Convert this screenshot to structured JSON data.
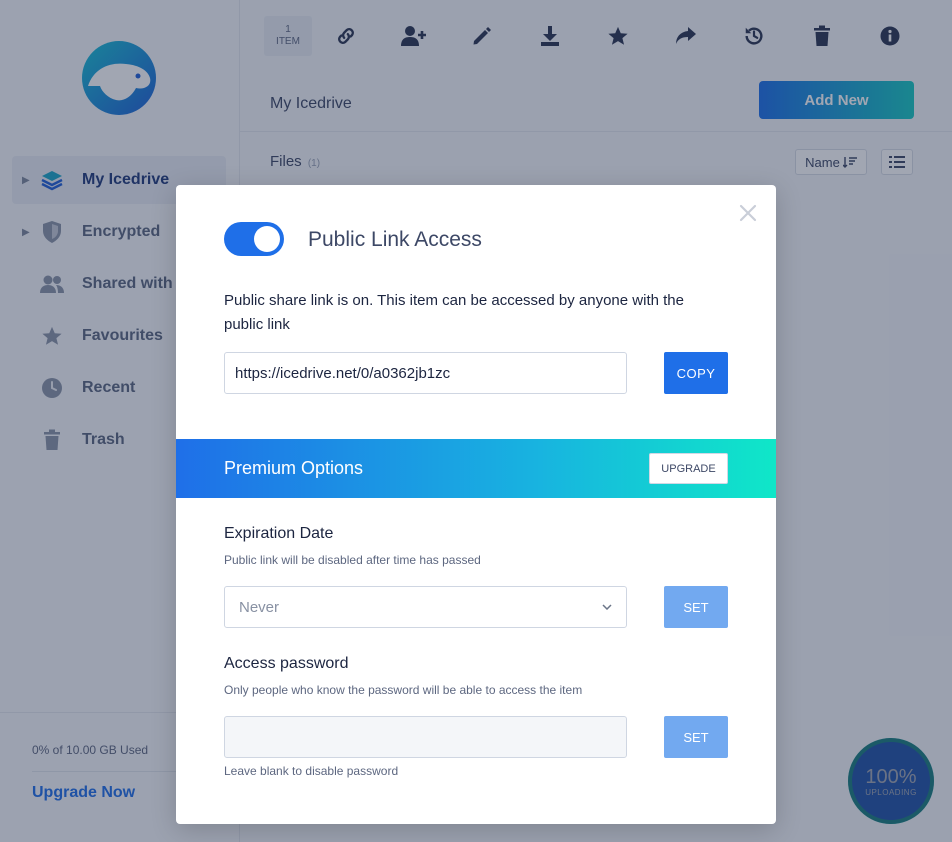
{
  "sidebar": {
    "items": [
      {
        "label": "My Icedrive",
        "icon": "layers-icon",
        "active": true
      },
      {
        "label": "Encrypted",
        "icon": "shield-icon"
      },
      {
        "label": "Shared with me",
        "icon": "users-icon"
      },
      {
        "label": "Favourites",
        "icon": "star-icon"
      },
      {
        "label": "Recent",
        "icon": "clock-icon"
      },
      {
        "label": "Trash",
        "icon": "trash-icon"
      }
    ],
    "storage_used": "0% of 10.00 GB Used",
    "upgrade_label": "Upgrade Now"
  },
  "toolbar": {
    "count_number": "1",
    "count_unit": "ITEM",
    "icons": [
      "link-icon",
      "add-user-icon",
      "pencil-icon",
      "download-icon",
      "star-icon",
      "share-icon",
      "history-icon",
      "trash-icon",
      "info-icon"
    ]
  },
  "main": {
    "breadcrumb": "My Icedrive",
    "add_new": "Add New",
    "files_label": "Files",
    "files_count": "(1)",
    "sort_label": "Name"
  },
  "modal": {
    "title": "Public Link Access",
    "toggle_on": true,
    "description": "Public share link is on. This item can be accessed by anyone with the public link",
    "link_url": "https://icedrive.net/0/a0362jb1zc",
    "copy_label": "COPY",
    "premium_title": "Premium Options",
    "upgrade_label": "UPGRADE",
    "expiration": {
      "title": "Expiration Date",
      "subtitle": "Public link will be disabled after time has passed",
      "selected": "Never",
      "set_label": "SET"
    },
    "password": {
      "title": "Access password",
      "subtitle": "Only people who know the password will be able to access the item",
      "value": "",
      "set_label": "SET",
      "hint": "Leave blank to disable password"
    }
  },
  "upload": {
    "percent": "100%",
    "status": "UPLOADING"
  },
  "colors": {
    "primary": "#1f6fe8",
    "accent": "#0fe7c8",
    "text": "#1c2540",
    "muted": "#5d6780"
  }
}
